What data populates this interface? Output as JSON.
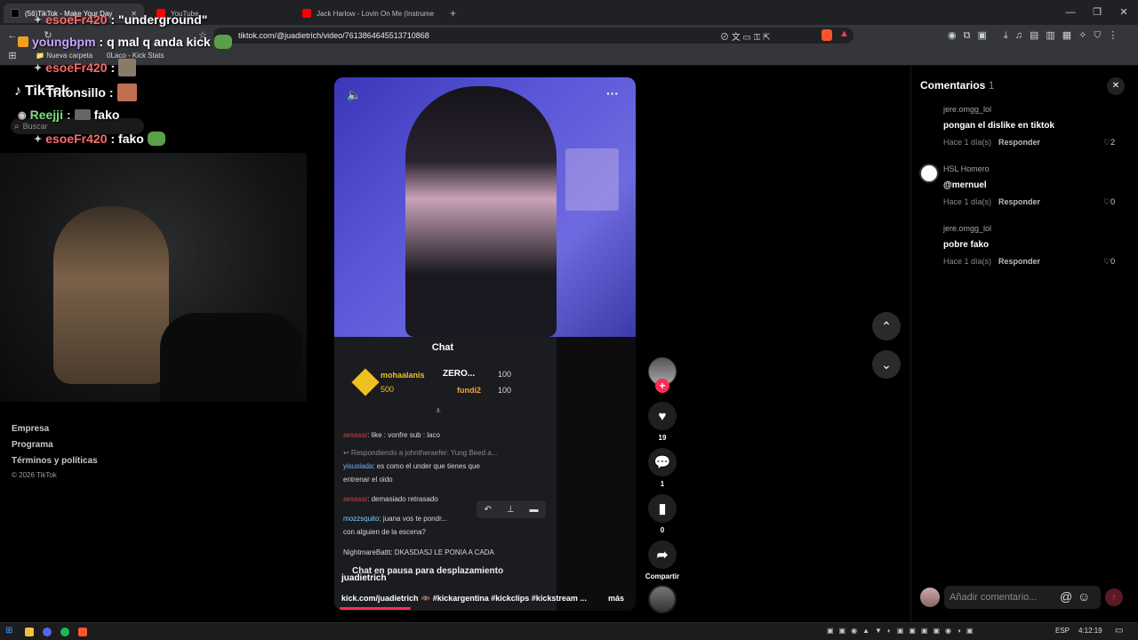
{
  "browser": {
    "tabs": [
      {
        "label": "(56)TikTok - Make Your Day",
        "active": true
      },
      {
        "label": "YouTube",
        "active": false
      },
      {
        "label": "Jack Harlow - Lovin On Me (Instrume",
        "active": false
      }
    ],
    "new_tab": "+",
    "url": "tiktok.com/@juadietrich/video/7613864645513710868",
    "bookmarks": [
      "Nueva carpeta",
      "0Laco - Kick Stats"
    ],
    "window_controls": [
      "minimize",
      "restore",
      "close"
    ]
  },
  "tiktok": {
    "logo": "TikTok",
    "search_placeholder": "Buscar",
    "footer_links": [
      "Empresa",
      "Programa",
      "Términos y políticas"
    ],
    "copyright": "© 2026 TikTok"
  },
  "stream_chat_overlay": [
    {
      "user": "esoeFr420",
      "message": ": \"underground\"",
      "color": "#ff6b6b"
    },
    {
      "user": "youngbpm",
      "message": ": q mal q anda kick",
      "color": "#c9a0ff"
    },
    {
      "user": "esoeFr420",
      "message": ":",
      "color": "#ff6b6b"
    },
    {
      "user": "Tritonsillo",
      "message": ":",
      "color": "#ffffff"
    },
    {
      "user": "Reejji",
      "message": "fako",
      "color": "#7be07b"
    },
    {
      "user": "esoeFr420",
      "message": ": fako",
      "color": "#ff6b6b"
    }
  ],
  "video": {
    "author": "juadietrich",
    "caption": "kick.com/juadietrich 🦇 #kickargentina #kickclips #kickstream ...",
    "more": "más",
    "embedded_chat": {
      "title": "Chat",
      "leaderboard": [
        {
          "name": "mohaalanis",
          "points": "500"
        },
        {
          "name": "ZERO...",
          "points": "100"
        },
        {
          "name": "fundi2",
          "points": "100"
        }
      ],
      "messages": [
        {
          "user": "sessssr",
          "text": ": like : vonfre sub : laco"
        },
        {
          "user": "",
          "text": "↩ Respondiendo a johntheraefer: Yung Beed a..."
        },
        {
          "user": "yisuslada",
          "text": ": es como el under que tienes que"
        },
        {
          "user": "",
          "text": "entrenar el oido"
        },
        {
          "user": "sessssr",
          "text": ": demasiado retrasado"
        },
        {
          "user": "mozzsquito",
          "text": ": juana vos te pondr..."
        },
        {
          "user": "",
          "text": "con alguien de la escena?"
        },
        {
          "user": "NightmareBattt",
          "text": ": DKASDASJ LE PONIA A CADA"
        }
      ],
      "paused_notice": "Chat en pausa para desplazamiento"
    },
    "likes": "19",
    "comments": "1",
    "saves": "0",
    "share_label": "Compartir"
  },
  "comments_panel": {
    "title": "Comentarios",
    "count": "1",
    "items": [
      {
        "user": "jere.omgg_lol",
        "text": "pongan el dislike en tiktok",
        "time": "Hace 1 día(s)",
        "reply": "Responder",
        "likes": "2"
      },
      {
        "user": "HSL Homero",
        "text": "@mernuel",
        "time": "Hace 1 día(s)",
        "reply": "Responder",
        "likes": "0"
      },
      {
        "user": "jere.omgg_lol",
        "text": "pobre fako",
        "time": "Hace 1 día(s)",
        "reply": "Responder",
        "likes": "0"
      }
    ],
    "input_placeholder": "Añadir comentario..."
  },
  "taskbar": {
    "language": "ESP",
    "time": "4:12:19"
  },
  "colors": {
    "tiktok_red": "#fe2c55",
    "kick_green": "#53fc18",
    "chrome_bg": "#202124"
  }
}
